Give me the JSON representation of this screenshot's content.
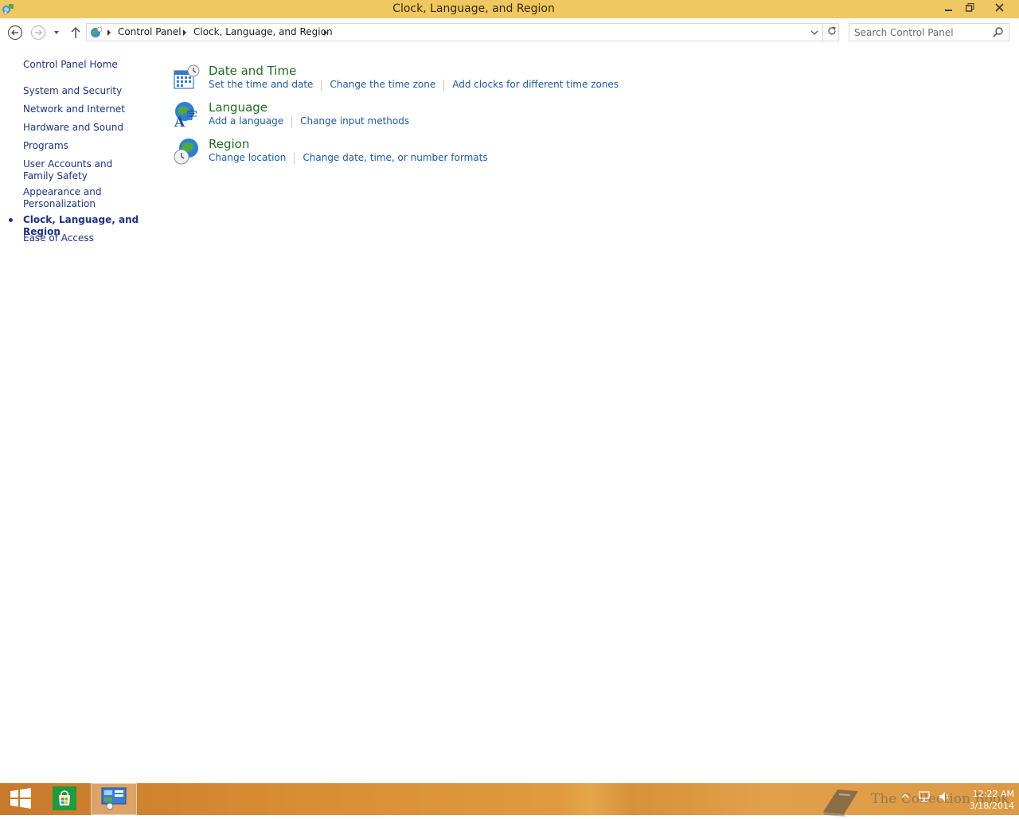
{
  "window": {
    "title": "Clock, Language, and Region",
    "app_icon": "control-panel-icon",
    "controls": [
      "minimize-icon",
      "restore-icon",
      "close-icon"
    ]
  },
  "navigation": {
    "back": "back-arrow-icon",
    "forward": "forward-arrow-icon",
    "recent": "chevron-down-icon",
    "up": "up-arrow-icon",
    "breadcrumb": [
      "Control Panel",
      "Clock, Language, and Region"
    ],
    "search": {
      "placeholder": "Search Control Panel",
      "value": ""
    }
  },
  "sidebar": {
    "home": "Control Panel Home",
    "items": [
      {
        "label": "System and Security"
      },
      {
        "label": "Network and Internet"
      },
      {
        "label": "Hardware and Sound"
      },
      {
        "label": "Programs"
      },
      {
        "label": "User Accounts and Family Safety"
      },
      {
        "label": "Appearance and Personalization"
      },
      {
        "label": "Clock, Language, and Region",
        "current": true
      },
      {
        "label": "Ease of Access"
      }
    ]
  },
  "categories": [
    {
      "title": "Date and Time",
      "icon": "calendar-clock-icon",
      "links": [
        "Set the time and date",
        "Change the time zone",
        "Add clocks for different time zones"
      ]
    },
    {
      "title": "Language",
      "icon": "language-globe-icon",
      "links": [
        "Add a language",
        "Change input methods"
      ]
    },
    {
      "title": "Region",
      "icon": "region-globe-clock-icon",
      "links": [
        "Change location",
        "Change date, time, or number formats"
      ]
    }
  ],
  "taskbar": {
    "buttons": [
      "start-windows-icon",
      "store-icon",
      "control-panel-taskbar-icon"
    ],
    "watermark": "The Collection Book",
    "tray_icons": [
      "show-hidden-icons-icon",
      "network-icon",
      "volume-icon"
    ],
    "clock": {
      "time": "12:22 AM",
      "date": "3/18/2014"
    }
  },
  "colors": {
    "titlebar": "#f0c861",
    "link": "#1e5aa8",
    "category_title": "#1e6e1e",
    "sidebar_link": "#1e3287"
  }
}
